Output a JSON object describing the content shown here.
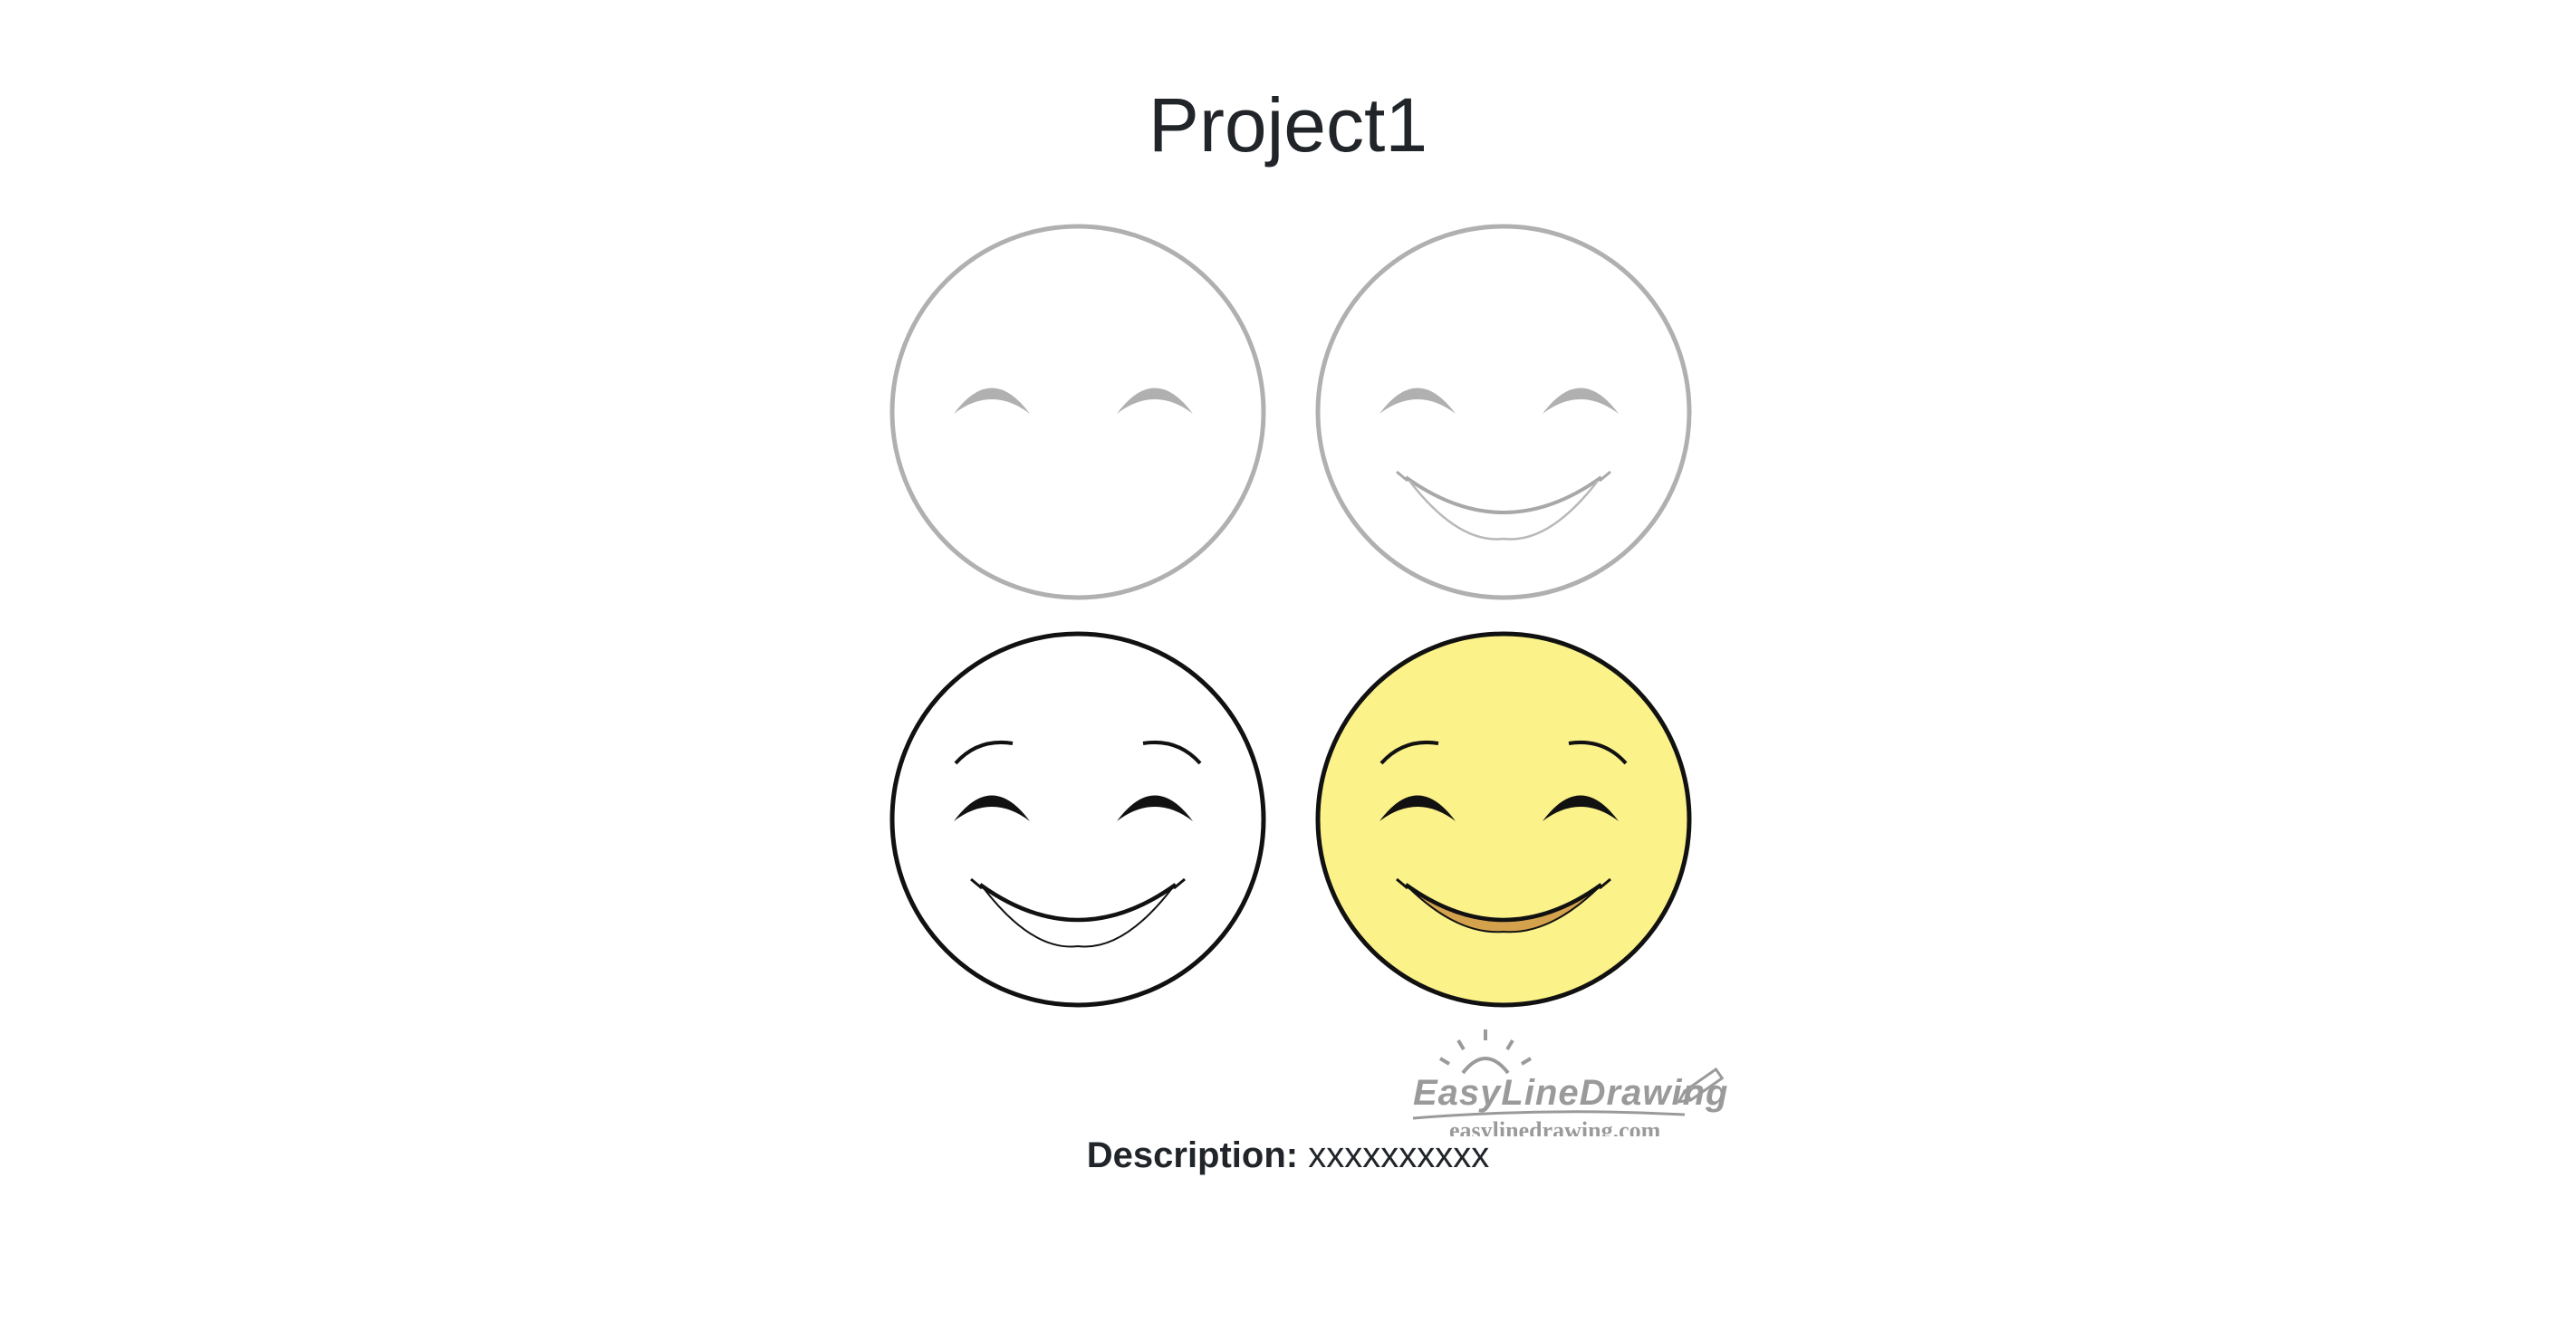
{
  "page": {
    "title": "Project1"
  },
  "description": {
    "label": "Description:",
    "value": "xxxxxxxxxx"
  },
  "watermark": {
    "brand": "EasyLineDrawing",
    "url": "easylinedrawing.com"
  },
  "colors": {
    "guide_gray": "#b0b0b0",
    "outline_black": "#111111",
    "face_yellow": "#fbf28a",
    "mouth_fill": "#d4a24c",
    "text": "#212529"
  },
  "icons": [
    "smiley-step-1-icon",
    "smiley-step-2-icon",
    "smiley-step-3-icon",
    "smiley-step-4-icon",
    "sun-icon",
    "pencil-icon"
  ]
}
